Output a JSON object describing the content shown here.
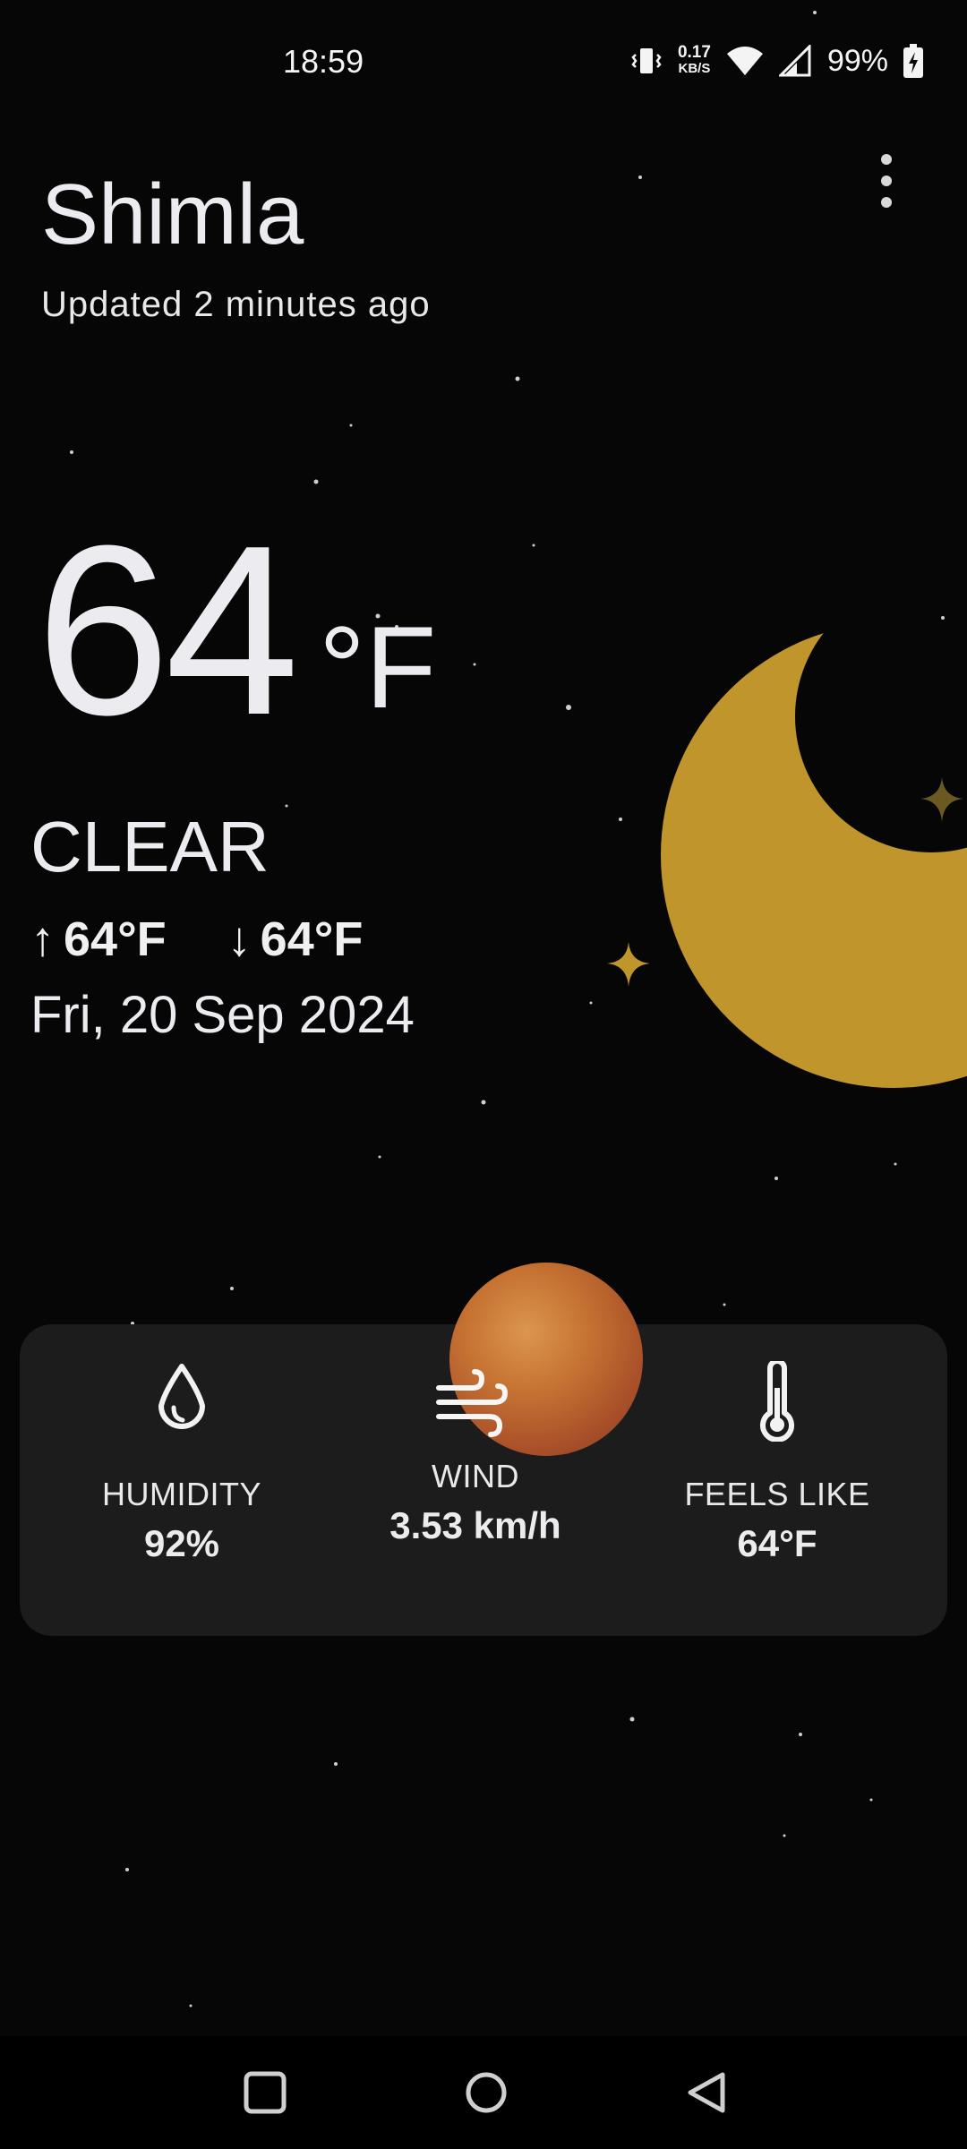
{
  "status_bar": {
    "time": "18:59",
    "net_speed_value": "0.17",
    "net_speed_unit": "KB/S",
    "battery": "99%",
    "icons": [
      "vibrate-icon",
      "wifi-icon",
      "signal-icon",
      "battery-charging-icon"
    ]
  },
  "header": {
    "city": "Shimla",
    "updated": "Updated 2 minutes ago",
    "menu_icon": "more-vert-icon"
  },
  "current": {
    "temperature": "64",
    "unit": "°F",
    "condition": "CLEAR",
    "high": "64°F",
    "low": "64°F",
    "high_arrow": "↑",
    "low_arrow": "↓",
    "date": "Fri, 20 Sep 2024"
  },
  "details": [
    {
      "icon": "water-drop-icon",
      "label": "HUMIDITY",
      "value": "92%"
    },
    {
      "icon": "wind-icon",
      "label": "WIND",
      "value": "3.53 km/h"
    },
    {
      "icon": "thermometer-icon",
      "label": "FEELS LIKE",
      "value": "64°F"
    }
  ],
  "colors": {
    "background": "#060606",
    "card": "#1c1c1c",
    "moon": "#c0962c",
    "text": "#ecebf0"
  },
  "navbar": {
    "icons": [
      "recents-square-icon",
      "home-circle-icon",
      "back-triangle-icon"
    ]
  }
}
